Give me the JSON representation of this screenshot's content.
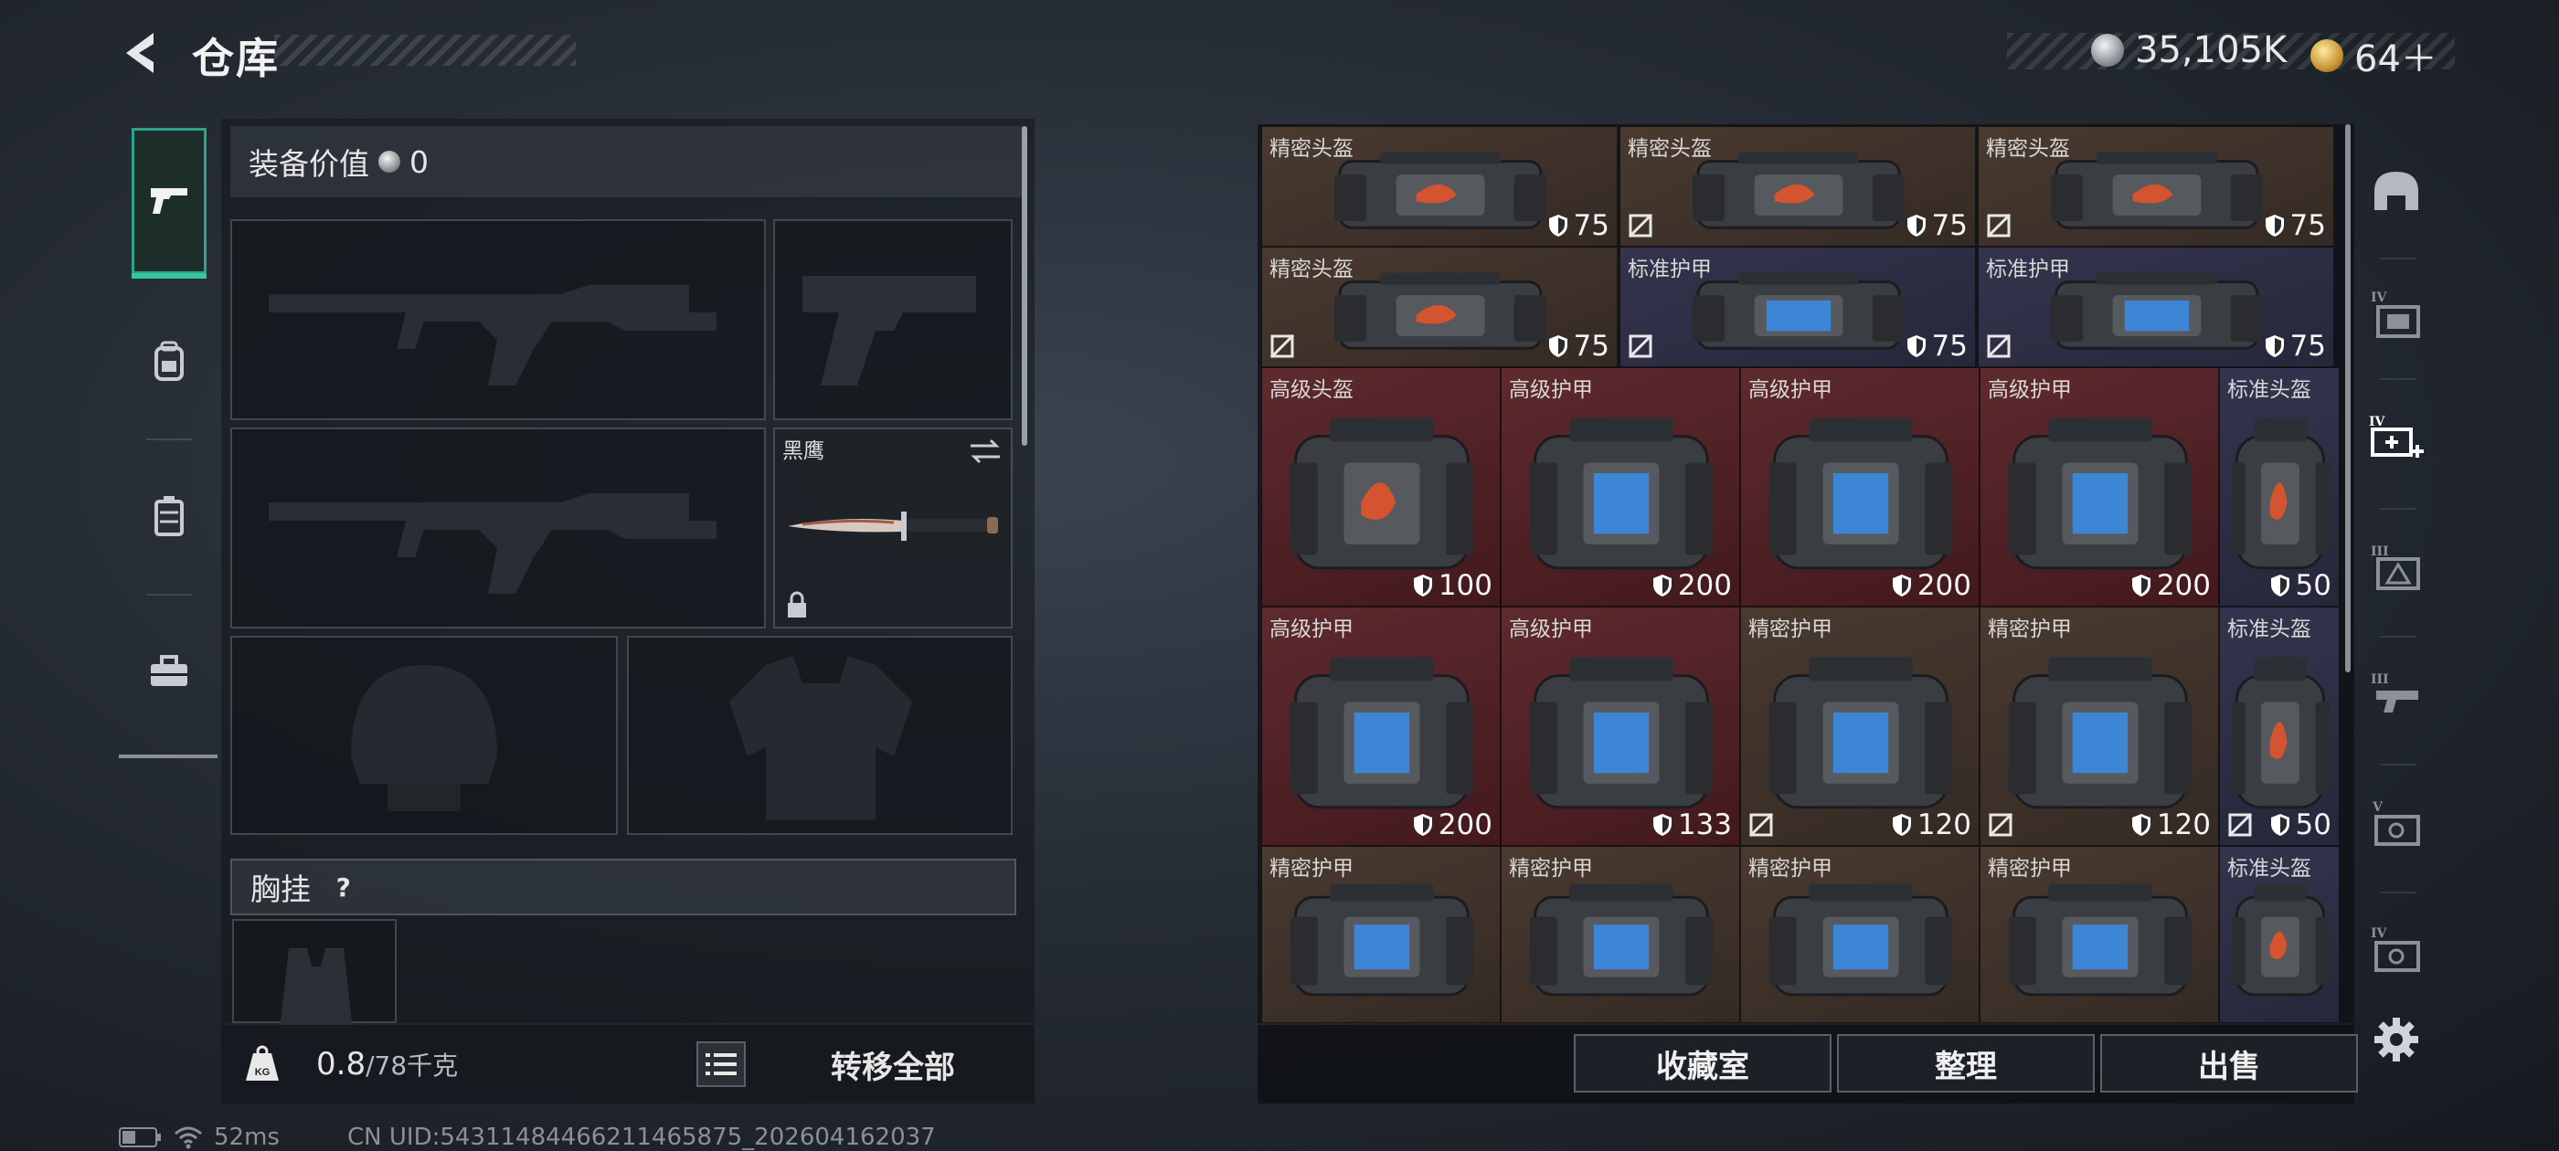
{
  "header": {
    "title": "仓库",
    "currency_silver": "35,105K",
    "currency_gold": "64＋"
  },
  "left_tabs": [
    "pistol-icon",
    "backpack-icon",
    "rig-icon",
    "toolbox-icon"
  ],
  "equipment": {
    "value_label": "装备价值",
    "value": "0",
    "knife_name": "黑鹰",
    "chest_label": "胸挂",
    "chest_help": "?"
  },
  "footer_left": {
    "weight_current": "0.8",
    "weight_max": "/78千克",
    "transfer_all": "转移全部"
  },
  "status": {
    "ping": "52ms",
    "uid": "CN UID:54311484466211465875_202604162037"
  },
  "inventory": {
    "items": [
      {
        "name": "精密头盔",
        "value": "75",
        "kind": "precision",
        "no_icon": false
      },
      {
        "name": "精密头盔",
        "value": "75",
        "kind": "precision",
        "no_icon": true
      },
      {
        "name": "精密头盔",
        "value": "75",
        "kind": "precision",
        "no_icon": true
      },
      {
        "name": "精密头盔",
        "value": "75",
        "kind": "precision",
        "no_icon": true
      },
      {
        "name": "标准护甲",
        "value": "75",
        "kind": "standard",
        "no_icon": true
      },
      {
        "name": "标准护甲",
        "value": "75",
        "kind": "standard",
        "no_icon": true
      },
      {
        "name": "高级头盔",
        "value": "100",
        "kind": "advanced",
        "no_icon": false
      },
      {
        "name": "高级护甲",
        "value": "200",
        "kind": "advanced",
        "no_icon": false
      },
      {
        "name": "高级护甲",
        "value": "200",
        "kind": "advanced",
        "no_icon": false
      },
      {
        "name": "高级护甲",
        "value": "200",
        "kind": "advanced",
        "no_icon": false
      },
      {
        "name": "标准头盔",
        "value": "50",
        "kind": "standard",
        "no_icon": false
      },
      {
        "name": "高级护甲",
        "value": "200",
        "kind": "advanced",
        "no_icon": false
      },
      {
        "name": "高级护甲",
        "value": "133",
        "kind": "advanced",
        "no_icon": false
      },
      {
        "name": "精密护甲",
        "value": "120",
        "kind": "precision",
        "no_icon": true
      },
      {
        "name": "精密护甲",
        "value": "120",
        "kind": "precision",
        "no_icon": true
      },
      {
        "name": "标准头盔",
        "value": "50",
        "kind": "standard",
        "no_icon": true
      },
      {
        "name": "精密护甲",
        "value": "",
        "kind": "precision",
        "no_icon": false
      },
      {
        "name": "精密护甲",
        "value": "",
        "kind": "precision",
        "no_icon": false
      },
      {
        "name": "精密护甲",
        "value": "",
        "kind": "precision",
        "no_icon": false
      },
      {
        "name": "精密护甲",
        "value": "",
        "kind": "precision",
        "no_icon": false
      },
      {
        "name": "标准头盔",
        "value": "",
        "kind": "standard",
        "no_icon": false
      }
    ]
  },
  "right_tabs": [
    "helmet-icon",
    "iv-armor-icon",
    "iv-add-icon",
    "iii-armor-icon",
    "iii-rig-icon",
    "v-case-icon",
    "iv-case-icon"
  ],
  "actions": {
    "collection": "收藏室",
    "organize": "整理",
    "sell": "出售"
  },
  "colors": {
    "accent": "#33c6a0",
    "precision": "#3d3129",
    "standard": "#2c2d44",
    "advanced": "#4f2024"
  }
}
